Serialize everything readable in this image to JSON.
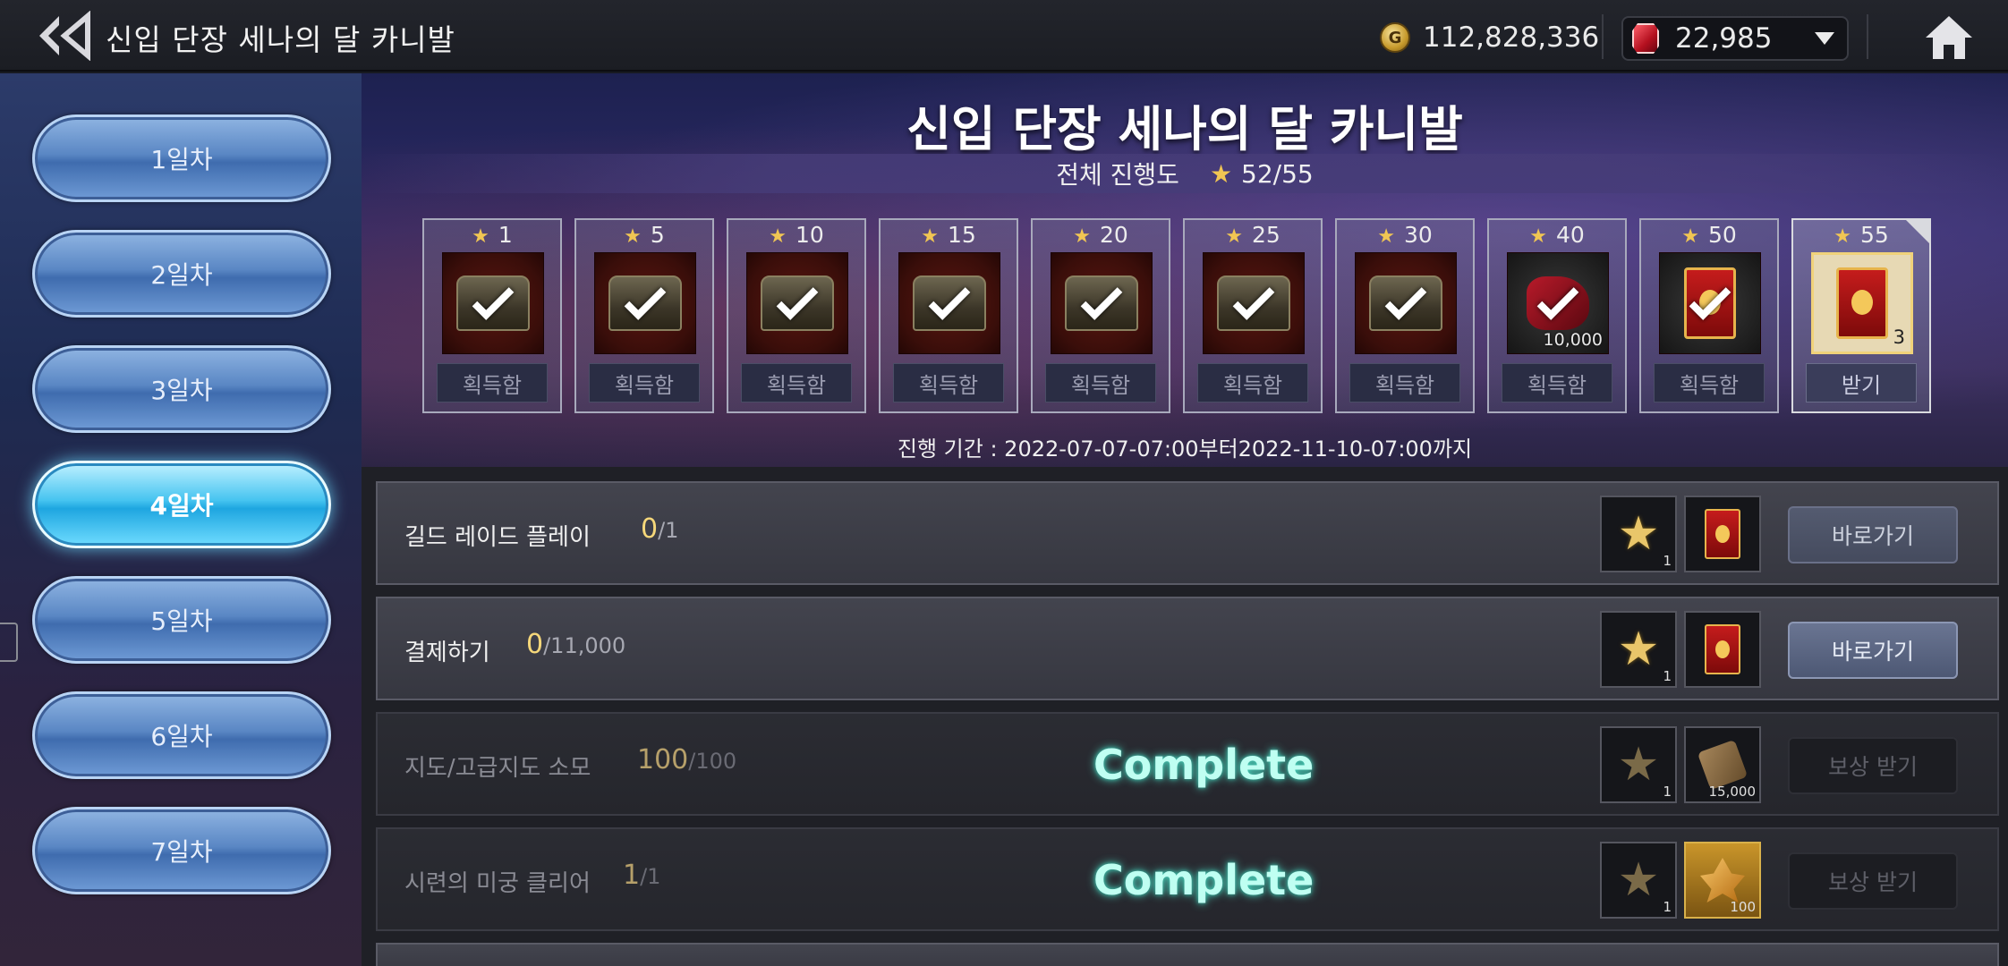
{
  "topbar": {
    "title": "신입 단장 세나의 달 카니발",
    "gold_symbol": "G",
    "gold": "112,828,336",
    "gems": "22,985"
  },
  "sidebar": {
    "days": [
      {
        "label": "1일차",
        "active": false
      },
      {
        "label": "2일차",
        "active": false
      },
      {
        "label": "3일차",
        "active": false
      },
      {
        "label": "4일차",
        "active": true
      },
      {
        "label": "5일차",
        "active": false
      },
      {
        "label": "6일차",
        "active": false
      },
      {
        "label": "7일차",
        "active": false
      }
    ]
  },
  "banner": {
    "title": "신입 단장 세나의 달 카니발",
    "progress_label": "전체 진행도",
    "progress_value": "52/55",
    "period": "진행 기간 : 2022-07-07-07:00부터2022-11-10-07:00까지",
    "rewards": [
      {
        "threshold": "1",
        "label": "획득함",
        "icon": "chest-icon",
        "claimed": true,
        "qty": ""
      },
      {
        "threshold": "5",
        "label": "획득함",
        "icon": "chest-icon",
        "claimed": true,
        "qty": ""
      },
      {
        "threshold": "10",
        "label": "획득함",
        "icon": "chest-icon",
        "claimed": true,
        "qty": ""
      },
      {
        "threshold": "15",
        "label": "획득함",
        "icon": "chest-icon",
        "claimed": true,
        "qty": ""
      },
      {
        "threshold": "20",
        "label": "획득함",
        "icon": "chest-icon",
        "claimed": true,
        "qty": ""
      },
      {
        "threshold": "25",
        "label": "획득함",
        "icon": "chest-icon",
        "claimed": true,
        "qty": ""
      },
      {
        "threshold": "30",
        "label": "획득함",
        "icon": "chest-icon",
        "claimed": true,
        "qty": ""
      },
      {
        "threshold": "40",
        "label": "획득함",
        "icon": "cloth-icon",
        "claimed": true,
        "qty": "10,000"
      },
      {
        "threshold": "50",
        "label": "획득함",
        "icon": "card-icon",
        "claimed": true,
        "qty": ""
      },
      {
        "threshold": "55",
        "label": "받기",
        "icon": "card-icon",
        "claimed": false,
        "qty": "3"
      }
    ]
  },
  "missions": [
    {
      "name": "길드 레이드 플레이",
      "current": "0",
      "total": "/1",
      "complete": false,
      "complete_label": "",
      "star_qty": "1",
      "reward_icon": "card-icon",
      "reward_qty": "",
      "button": "바로가기",
      "button_state": "muted"
    },
    {
      "name": "결제하기",
      "current": "0",
      "total": "/11,000",
      "complete": false,
      "complete_label": "",
      "star_qty": "1",
      "reward_icon": "card-icon",
      "reward_qty": "",
      "button": "바로가기",
      "button_state": "active"
    },
    {
      "name": "지도/고급지도 소모",
      "current": "100",
      "total": "/100",
      "complete": true,
      "complete_label": "Complete",
      "star_qty": "1",
      "reward_icon": "scroll-icon",
      "reward_qty": "15,000",
      "button": "보상 받기",
      "button_state": "disabled"
    },
    {
      "name": "시련의 미궁 클리어",
      "current": "1",
      "total": "/1",
      "complete": true,
      "complete_label": "Complete",
      "star_qty": "1",
      "reward_icon": "crystal-icon",
      "reward_qty": "100",
      "button": "보상 받기",
      "button_state": "disabled"
    }
  ]
}
